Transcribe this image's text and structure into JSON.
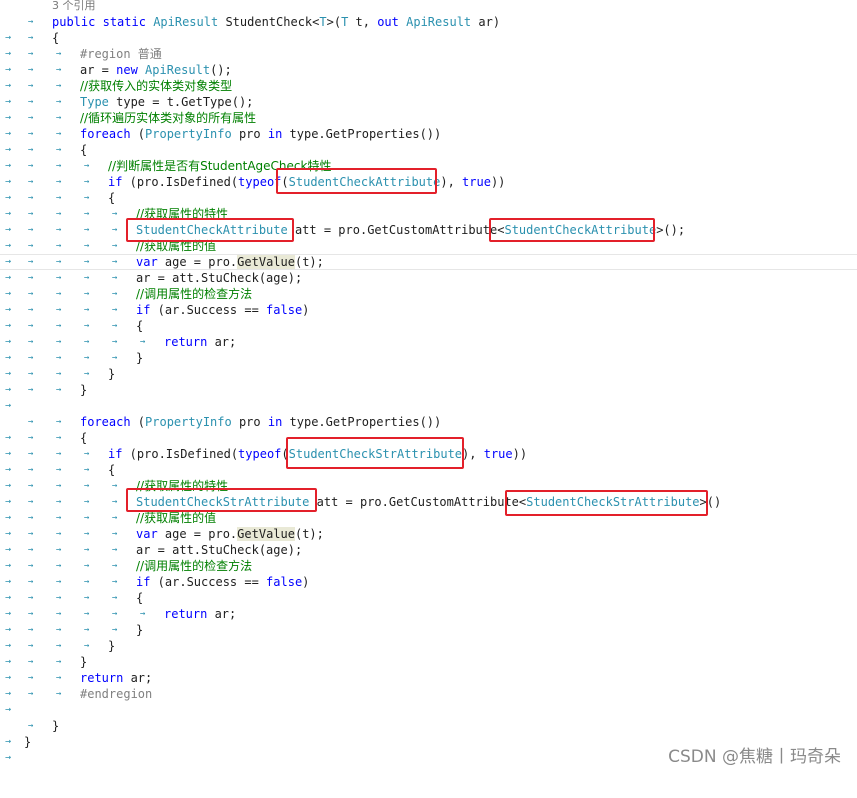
{
  "editor": {
    "ref_count": "3 个引用",
    "lines": [
      {
        "text": "public static ApiResult StudentCheck<T>(T t, out ApiResult ar)"
      },
      {
        "text": "{"
      },
      {
        "text": "#region 普通"
      },
      {
        "text": "ar = new ApiResult();"
      },
      {
        "text": "//获取传入的实体类对象类型"
      },
      {
        "text": "Type type = t.GetType();"
      },
      {
        "text": "//循环遍历实体类对象的所有属性"
      },
      {
        "text": "foreach (PropertyInfo pro in type.GetProperties())"
      },
      {
        "text": "{"
      },
      {
        "text": "//判断属性是否有StudentAgeCheck特性"
      },
      {
        "text": "if (pro.IsDefined(typeof(StudentCheckAttribute), true))"
      },
      {
        "text": "{"
      },
      {
        "text": "//获取属性的特性"
      },
      {
        "text": "StudentCheckAttribute att = pro.GetCustomAttribute<StudentCheckAttribute>();"
      },
      {
        "text": "//获取属性的值"
      },
      {
        "text": "var age = pro.GetValue(t);"
      },
      {
        "text": "ar = att.StuCheck(age);"
      },
      {
        "text": "//调用属性的检查方法"
      },
      {
        "text": "if (ar.Success == false)"
      },
      {
        "text": "{"
      },
      {
        "text": "return ar;"
      },
      {
        "text": "}"
      },
      {
        "text": "}"
      },
      {
        "text": "}"
      },
      {
        "text": ""
      },
      {
        "text": "foreach (PropertyInfo pro in type.GetProperties())"
      },
      {
        "text": "{"
      },
      {
        "text": "if (pro.IsDefined(typeof(StudentCheckStrAttribute), true))"
      },
      {
        "text": "{"
      },
      {
        "text": "//获取属性的特性"
      },
      {
        "text": "StudentCheckStrAttribute att = pro.GetCustomAttribute<StudentCheckStrAttribute>()"
      },
      {
        "text": "//获取属性的值"
      },
      {
        "text": "var age = pro.GetValue(t);"
      },
      {
        "text": "ar = att.StuCheck(age);"
      },
      {
        "text": "//调用属性的检查方法"
      },
      {
        "text": "if (ar.Success == false)"
      },
      {
        "text": "{"
      },
      {
        "text": "return ar;"
      },
      {
        "text": "}"
      },
      {
        "text": "}"
      },
      {
        "text": "}"
      },
      {
        "text": "return ar;"
      },
      {
        "text": "#endregion"
      },
      {
        "text": ""
      },
      {
        "text": "}"
      },
      {
        "text": "}"
      }
    ]
  },
  "watermark": "CSDN @焦糖丨玛奇朵",
  "colors": {
    "keyword": "#0000ff",
    "type": "#2b91af",
    "comment": "#008000",
    "preprocessor": "#808080",
    "annotation_box": "#e3202a"
  }
}
